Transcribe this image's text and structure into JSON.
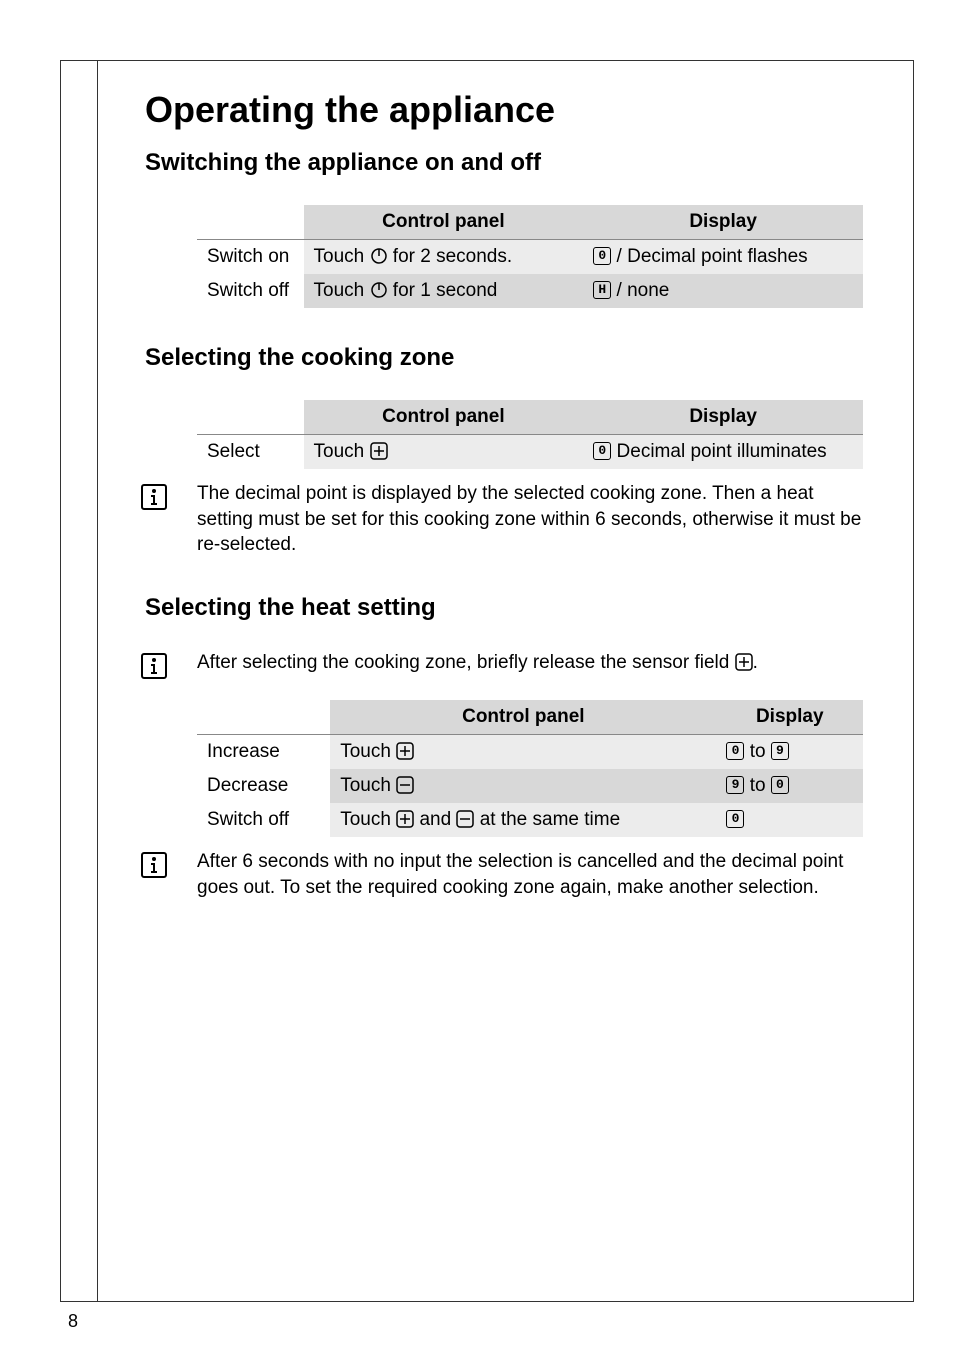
{
  "page_number": "8",
  "title": "Operating the appliance",
  "section1": {
    "heading": "Switching the appliance on and off",
    "headers": [
      "",
      "Control panel",
      "Display"
    ],
    "rows": [
      {
        "label": "Switch on",
        "control_before": "Touch ",
        "control_after": " for 2 seconds.",
        "display_before": "",
        "display_seg": "0",
        "display_after": " / Decimal point flashes"
      },
      {
        "label": "Switch off",
        "control_before": "Touch ",
        "control_after": " for 1 second",
        "display_before": "",
        "display_seg": "H",
        "display_after": " / none"
      }
    ]
  },
  "section2": {
    "heading": "Selecting the cooking zone",
    "headers": [
      "",
      "Control panel",
      "Display"
    ],
    "rows": [
      {
        "label": "Select",
        "control_before": "Touch ",
        "control_after": "",
        "display_before": "",
        "display_seg": "0",
        "display_after": " Decimal point illuminates"
      }
    ],
    "note": "The decimal point is displayed by the selected cooking zone. Then a heat setting must be set for this cooking zone within 6 seconds, otherwise it must be re-selected."
  },
  "section3": {
    "heading": "Selecting the heat setting",
    "intro_before": "After selecting the cooking zone, briefly release the sensor field ",
    "intro_after": ".",
    "headers": [
      "",
      "Control panel",
      "Display"
    ],
    "rows": [
      {
        "label": "Increase",
        "control_before": "Touch ",
        "control_icon": "plus",
        "control_after": "",
        "display_seg1": "0",
        "display_mid": " to ",
        "display_seg2": "9"
      },
      {
        "label": "Decrease",
        "control_before": "Touch ",
        "control_icon": "minus",
        "control_after": "",
        "display_seg1": "9",
        "display_mid": " to ",
        "display_seg2": "0"
      },
      {
        "label": "Switch off",
        "control_before": "Touch ",
        "control_icon": "plus",
        "control_mid": " and ",
        "control_icon2": "minus",
        "control_after": " at the same time",
        "display_seg1": "0",
        "display_mid": "",
        "display_seg2": ""
      }
    ],
    "note": "After 6 seconds with no input the selection is cancelled and the decimal point goes out. To set the required cooking zone again, make another selection."
  }
}
